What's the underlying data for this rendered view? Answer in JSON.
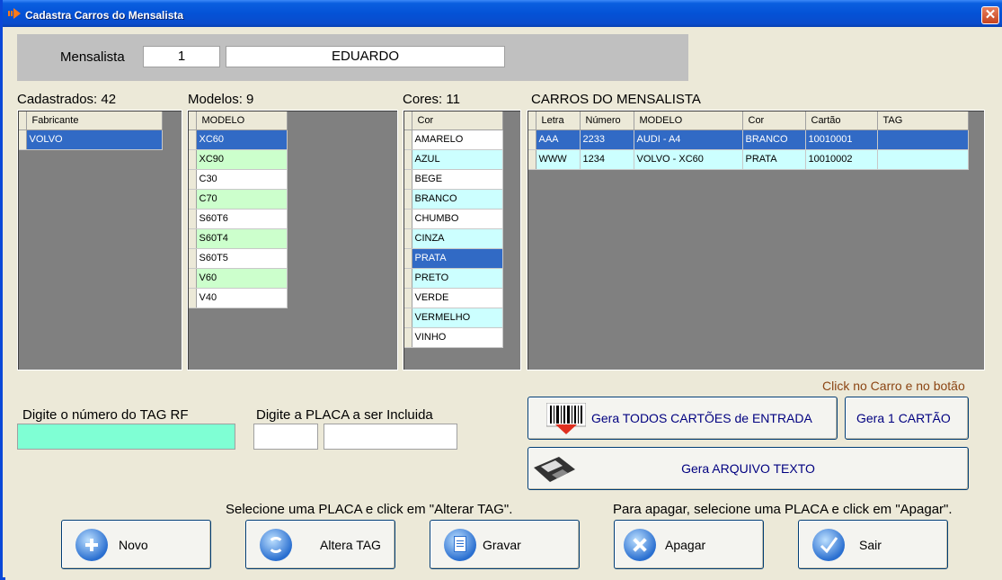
{
  "window": {
    "title": "Cadastra Carros do Mensalista",
    "close_symbol": "✕"
  },
  "header": {
    "label": "Mensalista",
    "id_value": "1",
    "name_value": "EDUARDO"
  },
  "cadastrados": {
    "title": "Cadastrados: 42",
    "column": "Fabricante",
    "rows": [
      {
        "value": "VOLVO",
        "selected": true
      }
    ]
  },
  "modelos": {
    "title": "Modelos: 9",
    "column": "MODELO",
    "rows": [
      "XC60",
      "XC90",
      "C30",
      "C70",
      "S60T6",
      "S60T4",
      "S60T5",
      "V60",
      "V40"
    ]
  },
  "cores": {
    "title": "Cores: 11",
    "column": "Cor",
    "rows": [
      "AMARELO",
      "AZUL",
      "BEGE",
      "BRANCO",
      "CHUMBO",
      "CINZA",
      "PRATA",
      "PRETO",
      "VERDE",
      "VERMELHO",
      "VINHO"
    ]
  },
  "carros": {
    "title": "CARROS DO MENSALISTA",
    "columns": [
      "Letra",
      "Número",
      "MODELO",
      "Cor",
      "Cartão",
      "TAG"
    ],
    "rows": [
      [
        "AAA",
        "2233",
        "AUDI - A4",
        "BRANCO",
        "10010001",
        ""
      ],
      [
        "WWW",
        "1234",
        "VOLVO - XC60",
        "PRATA",
        "10010002",
        ""
      ]
    ]
  },
  "hint_click": "Click no Carro e no botão",
  "tag": {
    "label": "Digite o número do TAG RF",
    "value": ""
  },
  "placa": {
    "label": "Digite a PLACA a ser Incluida",
    "letters_value": "",
    "numbers_value": ""
  },
  "buttons": {
    "gera_todos": "Gera TODOS CARTÕES de ENTRADA",
    "gera_um": "Gera 1 CARTÃO",
    "gera_arquivo": "Gera ARQUIVO TEXTO",
    "novo": "Novo",
    "altera_tag": "Altera TAG",
    "gravar": "Gravar",
    "apagar": "Apagar",
    "sair": "Sair"
  },
  "hint_alterar": "Selecione uma PLACA e click em \"Alterar TAG\".",
  "hint_apagar": "Para apagar, selecione uma PLACA e click em \"Apagar\".",
  "colors": {
    "titlebar": "#0452d6",
    "selected": "#316ac5",
    "green_row": "#ccffcc",
    "cyan_row": "#ccffff",
    "tag_input": "#7fffd4",
    "hint": "#8b4513",
    "button_text_blue": "#000080"
  }
}
